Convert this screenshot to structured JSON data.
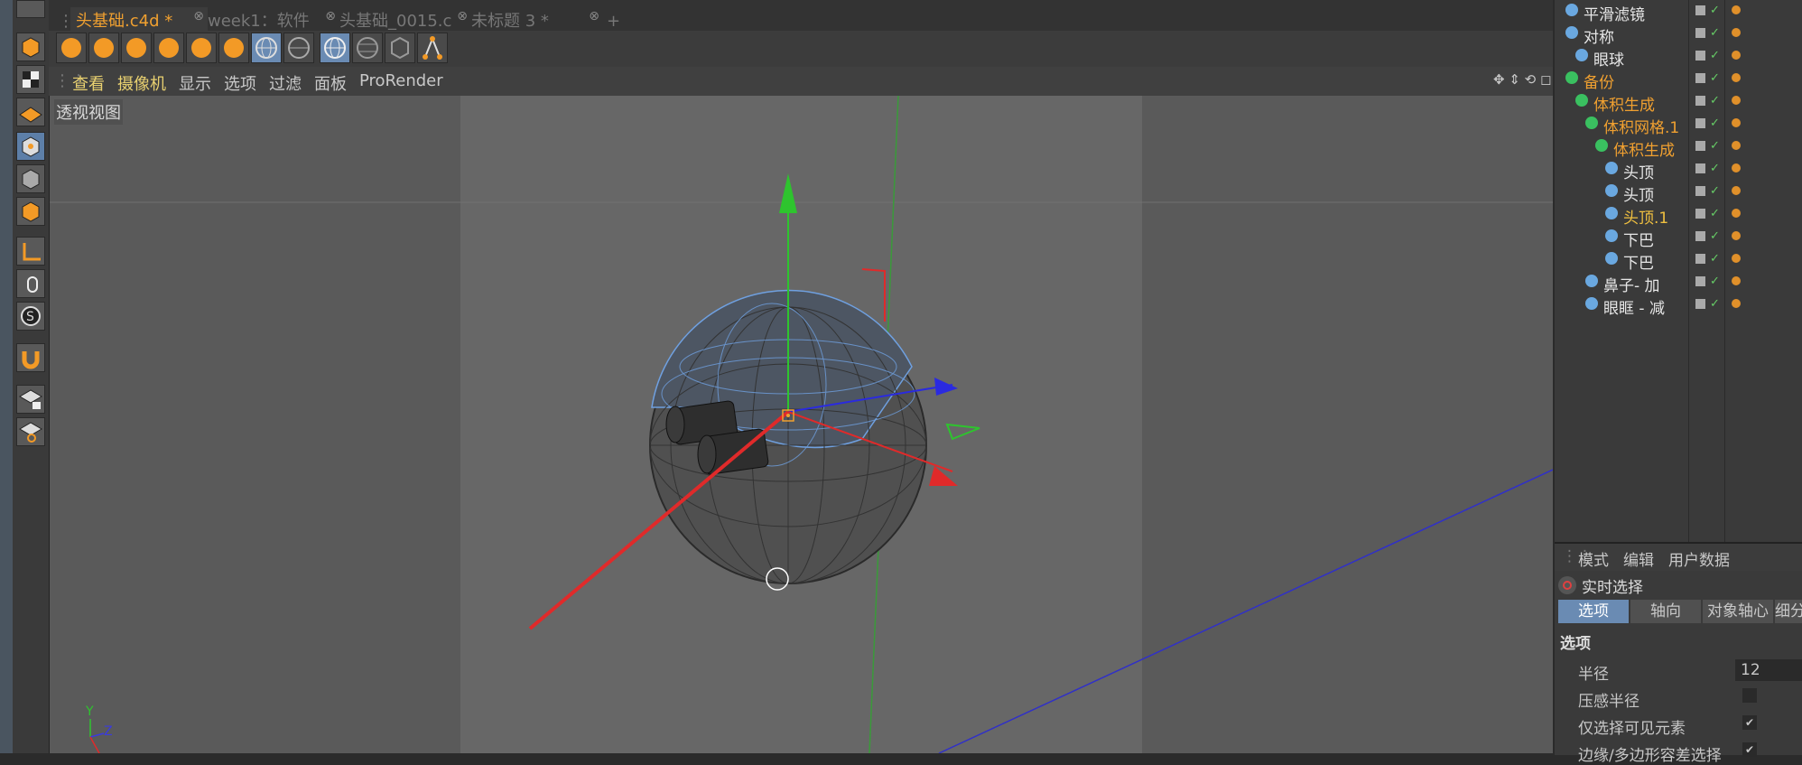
{
  "tabs": [
    {
      "label": "头基础.c4d *",
      "active": true
    },
    {
      "label": "week1：软件",
      "active": false
    },
    {
      "label": "头基础_0015.c",
      "active": false
    },
    {
      "label": "未标题 3 *",
      "active": false
    },
    {
      "label": "+",
      "active": false
    }
  ],
  "viewport_menu": [
    "查看",
    "摄像机",
    "显示",
    "选项",
    "过滤",
    "面板",
    "ProRender"
  ],
  "viewport_label": "透视视图",
  "axis_labels": {
    "y": "Y",
    "z": "Z"
  },
  "objects": [
    {
      "name": "平滑滤镜",
      "color": "#e6e6e6",
      "indent": 0
    },
    {
      "name": "对称",
      "color": "#e6e6e6",
      "indent": 0
    },
    {
      "name": "眼球",
      "color": "#e6e6e6",
      "indent": 1
    },
    {
      "name": "备份",
      "color": "#f0a030",
      "indent": 0
    },
    {
      "name": "体积生成",
      "color": "#f0a030",
      "indent": 1
    },
    {
      "name": "体积网格.1",
      "color": "#f0a030",
      "indent": 2
    },
    {
      "name": "体积生成",
      "color": "#f0a030",
      "indent": 3
    },
    {
      "name": "头顶",
      "color": "#e6e6e6",
      "indent": 4
    },
    {
      "name": "头顶",
      "color": "#e6e6e6",
      "indent": 4
    },
    {
      "name": "头顶.1",
      "color": "#f0c040",
      "indent": 4
    },
    {
      "name": "下巴",
      "color": "#e6e6e6",
      "indent": 4
    },
    {
      "name": "下巴",
      "color": "#e6e6e6",
      "indent": 4
    },
    {
      "name": "鼻子- 加",
      "color": "#e6e6e6",
      "indent": 2
    },
    {
      "name": "眼眶 - 减",
      "color": "#e6e6e6",
      "indent": 2
    }
  ],
  "attr": {
    "menu": [
      "模式",
      "编辑",
      "用户数据"
    ],
    "tool_name": "实时选择",
    "tabs": [
      "选项",
      "轴向",
      "对象轴心",
      "细分"
    ],
    "section": "选项",
    "fields": [
      {
        "label": "半径",
        "value": "12"
      },
      {
        "label": "压感半径",
        "value": ""
      },
      {
        "label": "仅选择可见元素",
        "value": "✔"
      },
      {
        "label": "边缘/多边形容差选择",
        "value": "✔"
      }
    ]
  }
}
